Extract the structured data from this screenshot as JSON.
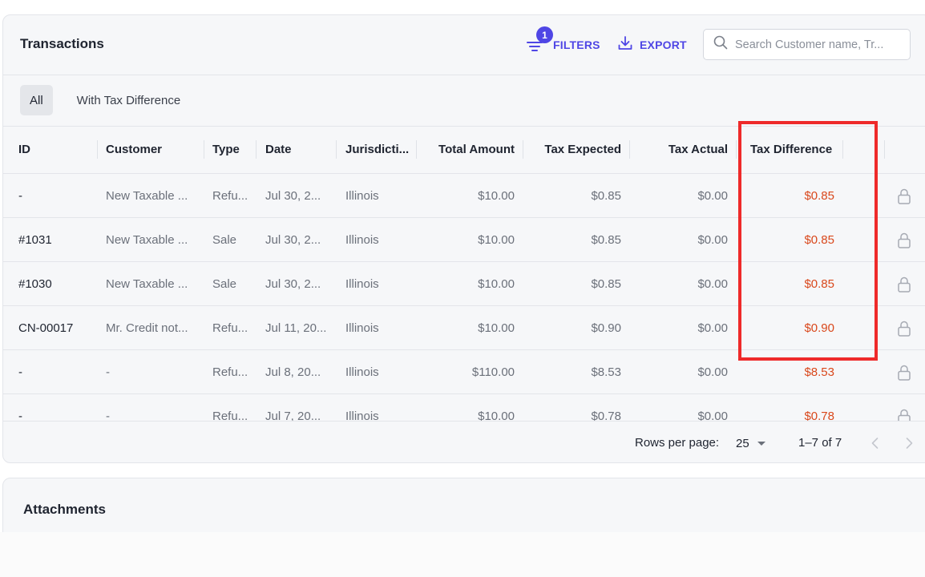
{
  "header": {
    "title": "Transactions",
    "filters_label": "FILTERS",
    "filters_count": "1",
    "export_label": "EXPORT",
    "search_placeholder": "Search Customer name, Tr..."
  },
  "tabs": [
    {
      "label": "All",
      "active": true
    },
    {
      "label": "With Tax Difference",
      "active": false
    }
  ],
  "table": {
    "columns": [
      "ID",
      "Customer",
      "Type",
      "Date",
      "Jurisdicti...",
      "Total Amount",
      "Tax Expected",
      "Tax Actual",
      "Tax Difference"
    ],
    "rows": [
      [
        "-",
        "New Taxable ...",
        "Refu...",
        "Jul 30, 2...",
        "Illinois",
        "$10.00",
        "$0.85",
        "$0.00",
        "$0.85"
      ],
      [
        "#1031",
        "New Taxable ...",
        "Sale",
        "Jul 30, 2...",
        "Illinois",
        "$10.00",
        "$0.85",
        "$0.00",
        "$0.85"
      ],
      [
        "#1030",
        "New Taxable ...",
        "Sale",
        "Jul 30, 2...",
        "Illinois",
        "$10.00",
        "$0.85",
        "$0.00",
        "$0.85"
      ],
      [
        "CN-00017",
        "Mr. Credit not...",
        "Refu...",
        "Jul 11, 20...",
        "Illinois",
        "$10.00",
        "$0.90",
        "$0.00",
        "$0.90"
      ],
      [
        "-",
        "-",
        "Refu...",
        "Jul 8, 20...",
        "Illinois",
        "$110.00",
        "$8.53",
        "$0.00",
        "$8.53"
      ],
      [
        "-",
        "-",
        "Refu...",
        "Jul 7, 20...",
        "Illinois",
        "$10.00",
        "$0.78",
        "$0.00",
        "$0.78"
      ]
    ]
  },
  "pagination": {
    "rows_per_page_label": "Rows per page:",
    "rows_per_page_value": "25",
    "range": "1–7 of 7"
  },
  "attachments": {
    "title": "Attachments"
  },
  "colors": {
    "accent": "#4f46e5",
    "difference": "#d9481c",
    "highlight": "#ee2a2a"
  },
  "icons": [
    "filter-icon",
    "download-icon",
    "search-icon",
    "lock-icon",
    "chevron-left-icon",
    "chevron-right-icon"
  ]
}
